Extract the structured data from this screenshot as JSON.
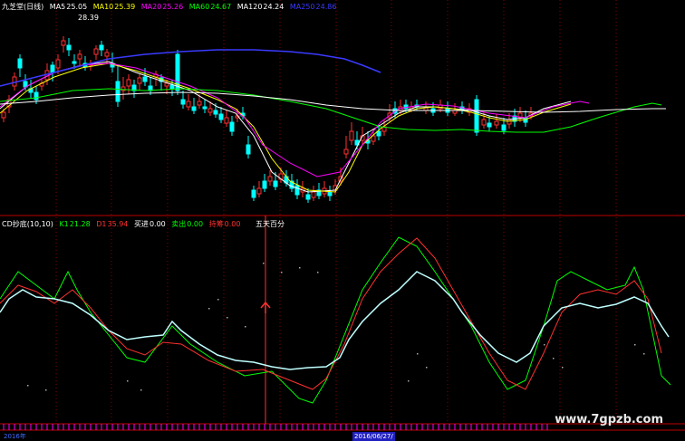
{
  "main_panel": {
    "stock_name": "九芝堂(日线)",
    "ma_indicators": [
      {
        "label": "MA5",
        "value": "25.05",
        "color": "#ffffff"
      },
      {
        "label": "MA10",
        "value": "25.39",
        "color": "#ffff00"
      },
      {
        "label": "MA20",
        "value": "25.26",
        "color": "#ff00ff"
      },
      {
        "label": "MA60",
        "value": "24.67",
        "color": "#00ff00"
      },
      {
        "label": "MA120",
        "value": "24.24",
        "color": "#ffffff"
      },
      {
        "label": "MA250",
        "value": "24.86",
        "color": "#3a3aff"
      }
    ],
    "high_label": "28.39"
  },
  "sub_panel": {
    "indicator_name": "CD抄底(10,10)",
    "lines": [
      {
        "label": "K1",
        "value": "21.28",
        "color": "#00ff00"
      },
      {
        "label": "D1",
        "value": "35.94",
        "color": "#ff3030"
      },
      {
        "label": "买进",
        "value": "0.00",
        "color": "#ffffff"
      },
      {
        "label": "卖出",
        "value": "0.00",
        "color": "#00ff00"
      },
      {
        "label": "持筹",
        "value": "0.00",
        "color": "#ff3030"
      }
    ],
    "extra_label": "五天百分"
  },
  "date_bar": {
    "left": "2016年",
    "middle": "2016/06/27/"
  },
  "watermark": "www.7gpzb.com",
  "colors": {
    "up": "#ff3030",
    "down": "#00ffff",
    "grid": "#8a0000",
    "axis": "#c00000"
  }
}
